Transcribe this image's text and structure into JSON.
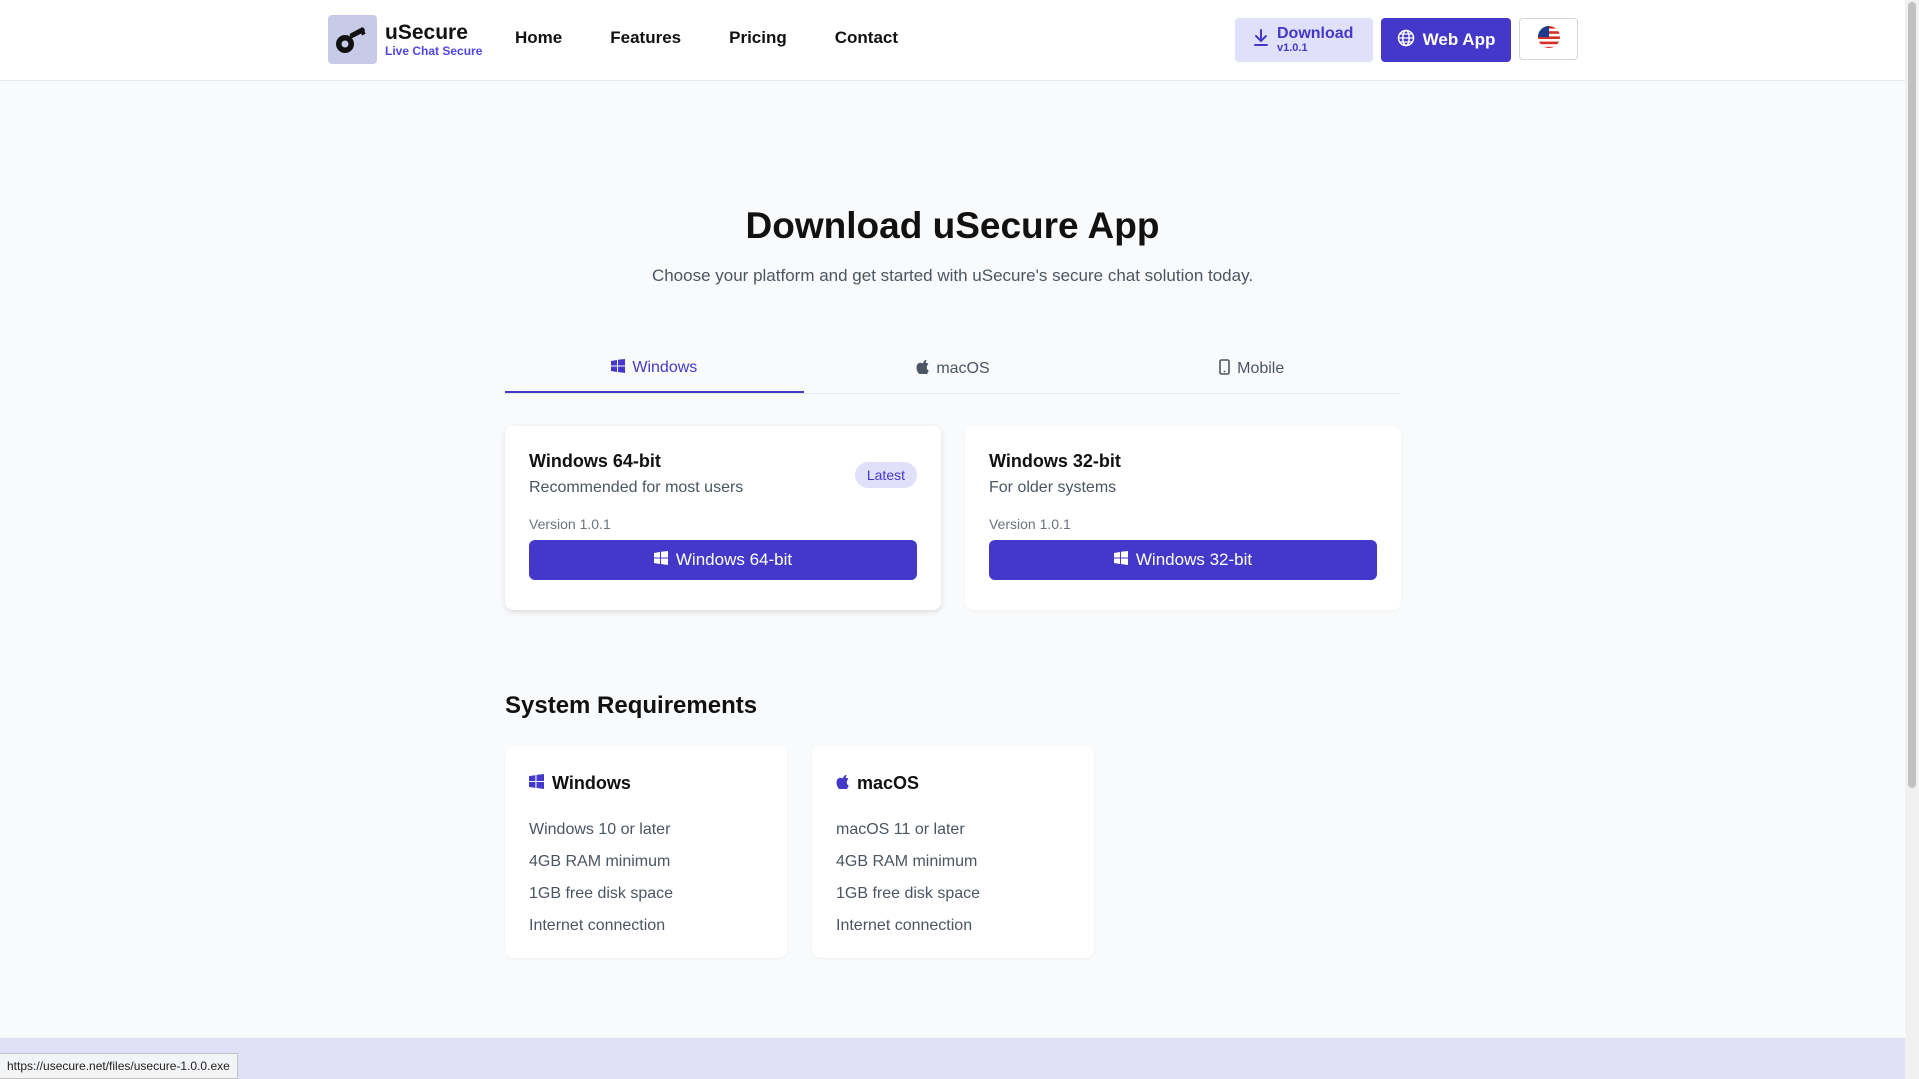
{
  "header": {
    "brand_name": "uSecure",
    "brand_tagline": "Live Chat Secure",
    "nav": [
      "Home",
      "Features",
      "Pricing",
      "Contact"
    ],
    "download_label": "Download",
    "download_version": "v1.0.1",
    "webapp_label": "Web App",
    "language_icon": "us-flag-icon"
  },
  "hero": {
    "title": "Download uSecure App",
    "subtitle": "Choose your platform and get started with uSecure's secure chat solution today."
  },
  "tabs": [
    {
      "label": "Windows",
      "icon": "windows-icon",
      "active": true
    },
    {
      "label": "macOS",
      "icon": "apple-icon",
      "active": false
    },
    {
      "label": "Mobile",
      "icon": "mobile-icon",
      "active": false
    }
  ],
  "downloads": [
    {
      "title": "Windows 64-bit",
      "description": "Recommended for most users",
      "badge": "Latest",
      "version": "Version 1.0.1",
      "button": "Windows 64-bit"
    },
    {
      "title": "Windows 32-bit",
      "description": "For older systems",
      "version": "Version 1.0.1",
      "button": "Windows 32-bit"
    }
  ],
  "requirements": {
    "heading": "System Requirements",
    "windows": {
      "title": "Windows",
      "items": [
        "Windows 10 or later",
        "4GB RAM minimum",
        "1GB free disk space",
        "Internet connection"
      ]
    },
    "macos": {
      "title": "macOS",
      "items": [
        "macOS 11 or later",
        "4GB RAM minimum",
        "1GB free disk space",
        "Internet connection"
      ]
    }
  },
  "status_bar": {
    "url": "https://usecure.net/files/usecure-1.0.0.exe"
  },
  "colors": {
    "accent": "#4338ca",
    "accent_light": "#e0e0fb",
    "background": "#f9fafb"
  }
}
